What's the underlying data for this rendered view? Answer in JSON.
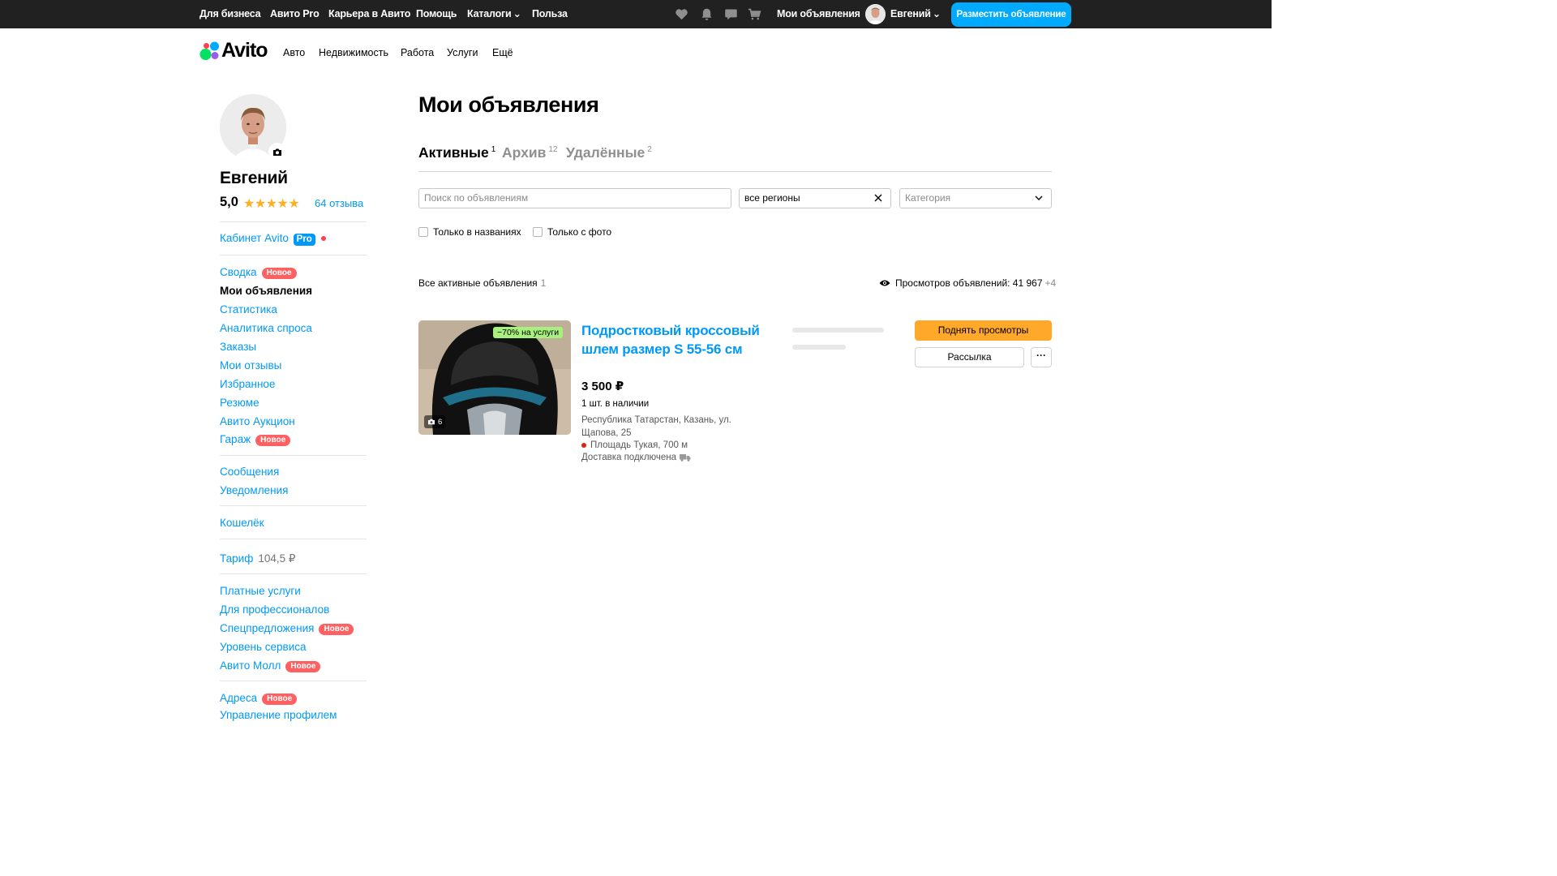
{
  "topbar": {
    "links": [
      "Для бизнеса",
      "Авито Pro",
      "Карьера в Авито",
      "Помощь",
      "Каталоги",
      "Польза"
    ],
    "catalogs_chevron": "⌄",
    "my_ads": "Мои объявления",
    "user_name": "Евгений",
    "post_button": "Разместить объявление"
  },
  "header": {
    "logo": "Avito",
    "nav": [
      "Авто",
      "Недвижимость",
      "Работа",
      "Услуги",
      "Ещё"
    ]
  },
  "sidebar": {
    "name": "Евгений",
    "rating": "5,0",
    "stars": "★★★★★",
    "reviews": "64 отзыва",
    "cabinet": "Кабинет Avito",
    "pro": "Pro",
    "group1": [
      {
        "label": "Сводка",
        "badge": "Новое"
      },
      {
        "label": "Мои объявления",
        "active": true
      },
      {
        "label": "Статистика"
      },
      {
        "label": "Аналитика спроса"
      },
      {
        "label": "Заказы"
      },
      {
        "label": "Мои отзывы"
      },
      {
        "label": "Избранное"
      },
      {
        "label": "Резюме"
      },
      {
        "label": "Авито Аукцион"
      },
      {
        "label": "Гараж",
        "badge": "Новое"
      }
    ],
    "messages": "Сообщения",
    "notifications": "Уведомления",
    "wallet": "Кошелёк",
    "tariff": "Тариф",
    "tariff_value": "104,5 ₽",
    "group2": [
      {
        "label": "Платные услуги"
      },
      {
        "label": "Для профессионалов"
      },
      {
        "label": "Спецпредложения",
        "badge": "Новое"
      },
      {
        "label": "Уровень сервиса"
      },
      {
        "label": "Авито Молл",
        "badge": "Новое"
      }
    ],
    "addresses": "Адреса",
    "addresses_badge": "Новое",
    "profile_mgmt": "Управление профилем"
  },
  "main": {
    "title": "Мои объявления",
    "tabs": [
      {
        "label": "Активные",
        "count": "1"
      },
      {
        "label": "Архив",
        "count": "12"
      },
      {
        "label": "Удалённые",
        "count": "2"
      }
    ],
    "search_placeholder": "Поиск по объявлениям",
    "region_value": "все регионы",
    "category_placeholder": "Категория",
    "only_titles": "Только в названиях",
    "only_photo": "Только с фото",
    "all_active": "Все активные объявления",
    "all_active_count": "1",
    "views_label": "Просмотров объявлений: 41 967",
    "views_plus": "+4"
  },
  "listing": {
    "discount": "−70% на услуги",
    "photo_count": "6",
    "title": "Подростковый кроссовый шлем размер S 55-56 см",
    "price": "3 500 ₽",
    "stock": "1 шт. в наличии",
    "address": "Республика Татарстан, Казань, ул. Щапова, 25",
    "metro": "Площадь Тукая, 700 м",
    "delivery": "Доставка подключена",
    "raise_button": "Поднять просмотры",
    "mailing_button": "Рассылка",
    "more_button": "···"
  },
  "colors": {
    "accent": "#0099f7",
    "topbar": "#212121",
    "post_button": "#00aaff",
    "raise_button": "#ffa829",
    "badge_new": "#ff6163",
    "star": "#ffb021",
    "discount": "#a8f07d"
  }
}
